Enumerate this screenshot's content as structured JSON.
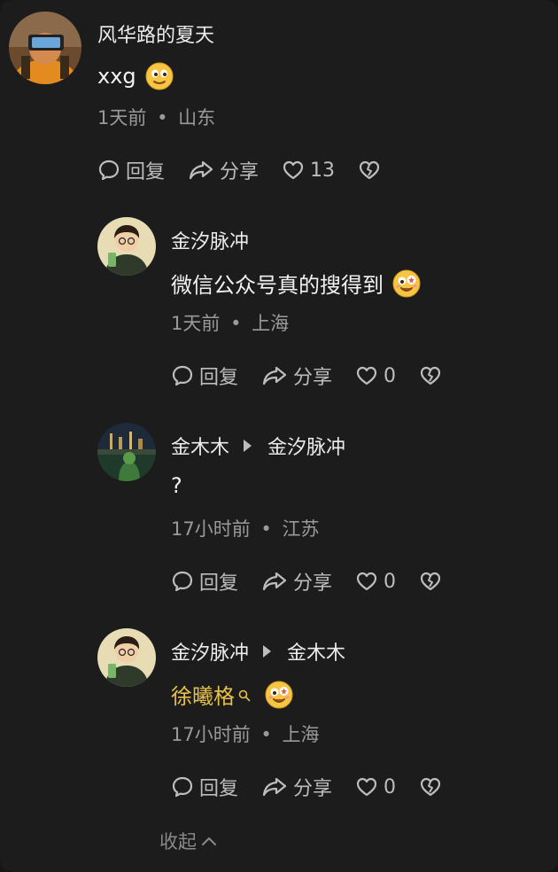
{
  "comments": [
    {
      "author": "风华路的夏天",
      "text": "xxg",
      "emoji": "smile-face-emoji",
      "time": "1天前",
      "location": "山东",
      "actions": {
        "reply": "回复",
        "share": "分享",
        "likes": "13"
      }
    },
    {
      "author": "金汐脉冲",
      "text": "微信公众号真的搜得到",
      "emoji": "starry-eyed-face-emoji",
      "time": "1天前",
      "location": "上海",
      "actions": {
        "reply": "回复",
        "share": "分享",
        "likes": "0"
      }
    },
    {
      "author": "金木木",
      "reply_to": "金汐脉冲",
      "text": "?",
      "time": "17小时前",
      "location": "江苏",
      "actions": {
        "reply": "回复",
        "share": "分享",
        "likes": "0"
      }
    },
    {
      "author": "金汐脉冲",
      "reply_to": "金木木",
      "link_text": "徐曦格",
      "emoji": "starry-eyed-face-emoji",
      "time": "17小时前",
      "location": "上海",
      "actions": {
        "reply": "回复",
        "share": "分享",
        "likes": "0"
      }
    }
  ],
  "separator": "•",
  "collapse_label": "收起",
  "colors": {
    "background": "#1c1c1c",
    "link": "#e6c04a",
    "secondary_text": "#9a9a9a",
    "icon": "#bdbdbd"
  }
}
